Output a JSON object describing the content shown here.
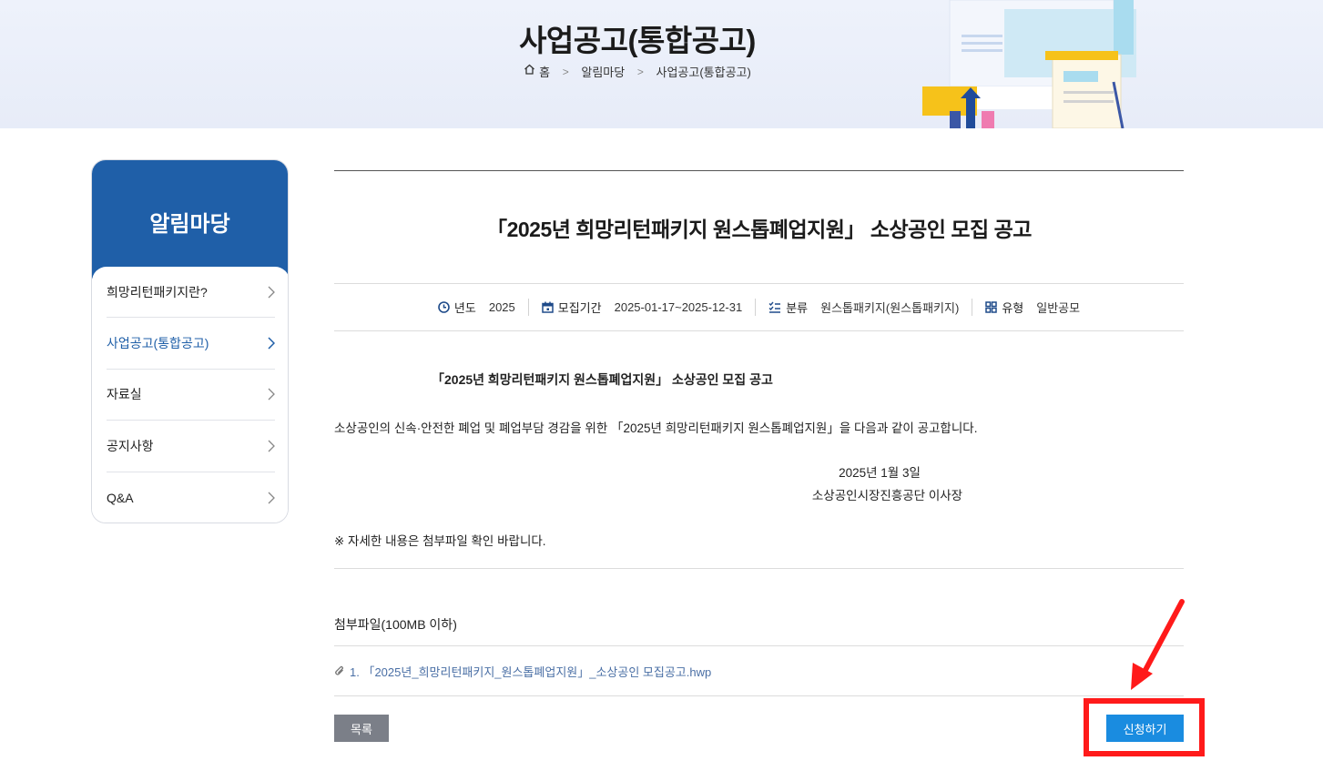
{
  "banner": {
    "title": "사업공고(통합공고)",
    "breadcrumb": [
      "홈",
      "알림마당",
      "사업공고(통합공고)"
    ]
  },
  "sidebar": {
    "title": "알림마당",
    "items": [
      {
        "label": "희망리턴패키지란?",
        "active": false
      },
      {
        "label": "사업공고(통합공고)",
        "active": true
      },
      {
        "label": "자료실",
        "active": false
      },
      {
        "label": "공지사항",
        "active": false
      },
      {
        "label": "Q&A",
        "active": false
      }
    ]
  },
  "post": {
    "title": "「2025년 희망리턴패키지 원스톱폐업지원」 소상공인 모집 공고",
    "meta": {
      "year_label": "년도",
      "year_value": "2025",
      "period_label": "모집기간",
      "period_value": "2025-01-17~2025-12-31",
      "category_label": "분류",
      "category_value": "원스톱패키지(원스톱패키지)",
      "type_label": "유형",
      "type_value": "일반공모"
    },
    "body": {
      "heading": "「2025년 희망리턴패키지 원스톱폐업지원」 소상공인 모집 공고",
      "paragraph": "소상공인의 신속·안전한 폐업 및 폐업부담 경감을 위한 「2025년 희망리턴패키지 원스톱폐업지원」을 다음과 같이 공고합니다.",
      "date": "2025년 1월 3일",
      "org": "소상공인시장진흥공단 이사장",
      "note": "※ 자세한 내용은 첨부파일 확인 바랍니다."
    },
    "attachments": {
      "title": "첨부파일(100MB 이하)",
      "files": [
        "1. 「2025년_희망리턴패키지_원스톱폐업지원」_소상공인 모집공고.hwp"
      ]
    }
  },
  "buttons": {
    "list_label": "목록",
    "apply_label": "신청하기"
  },
  "colors": {
    "brand": "#1f5fa8",
    "apply": "#1a8ce0",
    "highlight": "#ff1a1a",
    "list_button": "#7b7f88"
  }
}
